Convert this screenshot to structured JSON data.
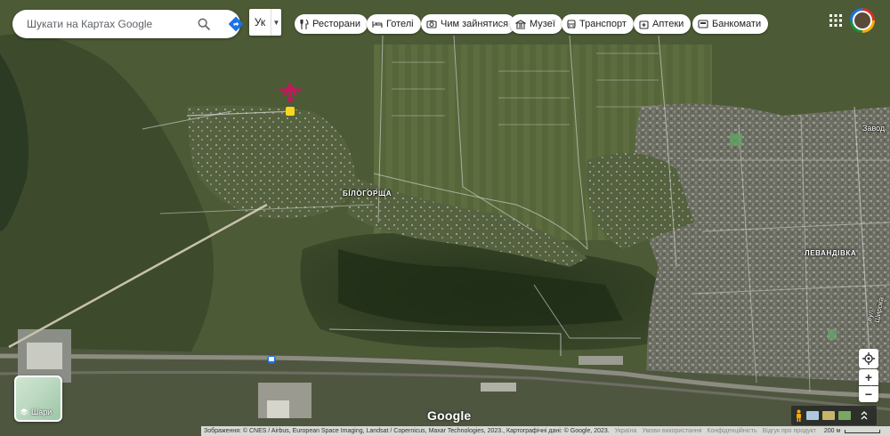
{
  "search": {
    "placeholder": "Шукати на Картах Google"
  },
  "layer_switch": {
    "label": "Ук"
  },
  "chips": [
    {
      "label": "Ресторани",
      "icon": "fork-knife-icon"
    },
    {
      "label": "Готелі",
      "icon": "bed-icon"
    },
    {
      "label": "Чим зайнятися",
      "icon": "camera-icon"
    },
    {
      "label": "Музеї",
      "icon": "museum-icon"
    },
    {
      "label": "Транспорт",
      "icon": "bus-icon"
    },
    {
      "label": "Аптеки",
      "icon": "pharmacy-icon"
    },
    {
      "label": "Банкомати",
      "icon": "atm-icon"
    }
  ],
  "places": {
    "bilohorshcha": "БІЛОГОРЩА",
    "levandivka": "ЛЕВАНДІВКА",
    "zavod": "Завод",
    "street": "вул. Широка"
  },
  "layers": {
    "label": "Шари"
  },
  "brand": {
    "logo": "Google"
  },
  "footer": {
    "attribution": "Зображення: © CNES / Airbus, European Space Imaging, Landsat / Copernicus, Maxar Technologies, 2023., Картографічні дані: © Google, 2023.",
    "country": "Україна",
    "terms": "Умови використання",
    "privacy": "Конфіденційність",
    "feedback": "Відгук про продукт",
    "scale": "200 м"
  },
  "colors": {
    "accent": "#1a73e8",
    "marker": "#c2185b",
    "marker_dot": "#f9d71c"
  }
}
